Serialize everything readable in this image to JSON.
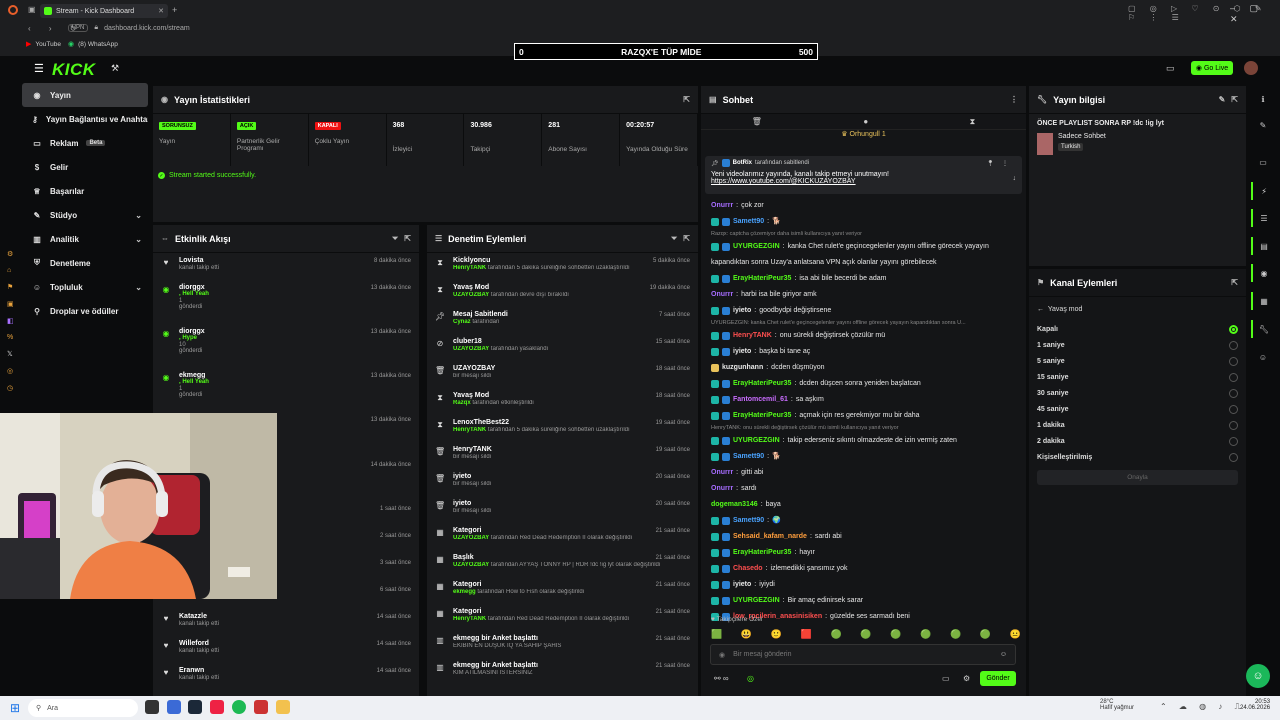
{
  "browser": {
    "tab_title": "Stream - Kick Dashboard",
    "url": "dashboard.kick.com/stream",
    "vpn": "VPN",
    "bookmarks": [
      "YouTube",
      "(8) WhatsApp"
    ]
  },
  "overlay": {
    "goal_left": "0",
    "goal_title": "RAZQX'E TÜP MİDE",
    "goal_right": "500"
  },
  "header": {
    "logo": "KICK",
    "go_live": "Go Live"
  },
  "nav": {
    "items": [
      "Yayın",
      "Yayın Bağlantısı ve Anahtarı",
      "Reklam",
      "Gelir",
      "Başarılar",
      "Stüdyo",
      "Analitik",
      "Denetleme",
      "Topluluk",
      "Droplar ve ödüller"
    ],
    "beta": "Beta"
  },
  "stats": {
    "title": "Yayın İstatistikleri",
    "items": [
      {
        "value": "SORUNSUZ",
        "label": "Yayın",
        "kind": "green"
      },
      {
        "value": "AÇIK",
        "label": "Partnerlik Gelir Programı",
        "kind": "green"
      },
      {
        "value": "KAPALI",
        "label": "Çoklu Yayın",
        "kind": "red"
      },
      {
        "value": "368",
        "label": "İzleyici",
        "kind": "num"
      },
      {
        "value": "30.986",
        "label": "Takipçi",
        "kind": "num"
      },
      {
        "value": "281",
        "label": "Abone Sayısı",
        "kind": "num"
      },
      {
        "value": "00:20:57",
        "label": "Yayında Olduğu Süre",
        "kind": "num"
      }
    ],
    "success": "Stream started successfully."
  },
  "activity": {
    "title": "Etkinlik Akışı",
    "rows": [
      {
        "icon": "heart",
        "name": "Lovista",
        "sub": "kanalı takip etti",
        "green": "",
        "time": "8 dakika önce",
        "h": 27
      },
      {
        "icon": "kick",
        "name": "diorggx",
        "sub": "1\ngönderdi",
        "green": ", Hell Yeah",
        "time": "13 dakika önce",
        "h": 44
      },
      {
        "icon": "kick",
        "name": "diorggx",
        "sub": "10\ngönderdi",
        "green": ", Hype",
        "time": "13 dakika önce",
        "h": 44
      },
      {
        "icon": "kick",
        "name": "ekmegg",
        "sub": "1\ngönderdi",
        "green": ", Hell Yeah",
        "time": "13 dakika önce",
        "h": 44
      },
      {
        "icon": "",
        "name": "",
        "sub": "",
        "green": "",
        "time": "13 dakika önce",
        "h": 45
      },
      {
        "icon": "",
        "name": "",
        "sub": "",
        "green": "",
        "time": "14 dakika önce",
        "h": 44
      },
      {
        "icon": "",
        "name": "",
        "sub": "",
        "green": "",
        "time": "1 saat önce",
        "h": 27
      },
      {
        "icon": "",
        "name": "",
        "sub": "",
        "green": "",
        "time": "2 saat önce",
        "h": 27
      },
      {
        "icon": "",
        "name": "",
        "sub": "",
        "green": "",
        "time": "3 saat önce",
        "h": 27
      },
      {
        "icon": "",
        "name": "",
        "sub": "kanalı takip etti",
        "green": "",
        "time": "6 saat önce",
        "h": 27
      },
      {
        "icon": "heart",
        "name": "Katazzle",
        "sub": "kanalı takip etti",
        "green": "",
        "time": "14 saat önce",
        "h": 27
      },
      {
        "icon": "heart",
        "name": "Willeford",
        "sub": "kanalı takip etti",
        "green": "",
        "time": "14 saat önce",
        "h": 27
      },
      {
        "icon": "heart",
        "name": "Eranwn",
        "sub": "kanalı takip etti",
        "green": "",
        "time": "14 saat önce",
        "h": 27
      }
    ]
  },
  "moderation": {
    "title": "Denetim Eylemleri",
    "rows": [
      {
        "icon": "hourglass",
        "name": "Kicklyoncu",
        "user": "HenryTANK",
        "sub": " tarafından 5 dakika süreliğine sohbetten uzaklaştırıldı",
        "time": "5 dakika önce"
      },
      {
        "icon": "hourglass",
        "name": "Yavaş Mod",
        "user": "UZAYOZBAY",
        "sub": " tarafından devre dışı bırakıldı",
        "time": "19 dakika önce"
      },
      {
        "icon": "pin",
        "name": "Mesaj Sabitlendi",
        "user": "Cynaz",
        "sub": " tarafından",
        "time": "7 saat önce"
      },
      {
        "icon": "ban",
        "name": "cluber18",
        "user": "UZAYOZBAY",
        "sub": " tarafından yasaklandı",
        "time": "15 saat önce"
      },
      {
        "icon": "trash",
        "name": "UZAYOZBAY",
        "user": "",
        "sub": "bir mesajı sildi",
        "time": "18 saat önce"
      },
      {
        "icon": "hourglass",
        "name": "Yavaş Mod",
        "user": "Razqx",
        "sub": " tarafından etkinleştirildi",
        "time": "18 saat önce"
      },
      {
        "icon": "hourglass",
        "name": "LenoxTheBest22",
        "user": "HenryTANK",
        "sub": " tarafından 5 dakika süreliğine sohbetten uzaklaştırıldı",
        "time": "19 saat önce"
      },
      {
        "icon": "trash",
        "name": "HenryTANK",
        "user": "",
        "sub": "bir mesajı sildi",
        "time": "19 saat önce"
      },
      {
        "icon": "trash",
        "name": "iyieto",
        "user": "",
        "sub": "bir mesajı sildi",
        "time": "20 saat önce"
      },
      {
        "icon": "trash",
        "name": "iyieto",
        "user": "",
        "sub": "bir mesajı sildi",
        "time": "20 saat önce"
      },
      {
        "icon": "cat",
        "name": "Kategori",
        "user": "UZAYOZBAY",
        "sub": " tarafından Red Dead Redemption II olarak değiştirildi",
        "time": "21 saat önce"
      },
      {
        "icon": "cat",
        "name": "Başlık",
        "user": "UZAYOZBAY",
        "sub": " tarafından AYYAŞ TONNY RP | RDR !dc !ig lyt olarak değiştirildi",
        "time": "21 saat önce"
      },
      {
        "icon": "cat",
        "name": "Kategori",
        "user": "ekmegg",
        "sub": " tarafından How to Fish olarak değiştirildi",
        "time": "21 saat önce"
      },
      {
        "icon": "cat",
        "name": "Kategori",
        "user": "HenryTANK",
        "sub": " tarafından Red Dead Redemption II olarak değiştirildi",
        "time": "21 saat önce"
      },
      {
        "icon": "poll",
        "name": "ekmegg bir Anket başlattı",
        "user": "",
        "sub": "EKİBİN EN DÜŞÜK IQ YA SAHİP ŞAHIS",
        "time": "21 saat önce"
      },
      {
        "icon": "poll",
        "name": "ekmegg bir Anket başlattı",
        "user": "",
        "sub": "KİM ATILMASINI İSTERSİNİZ",
        "time": "21 saat önce"
      }
    ]
  },
  "chat": {
    "title": "Sohbet",
    "top_user": "Orhungull",
    "top_count": "1",
    "pinned_by": "BotRix",
    "pinned_label": "tarafından sabitlendi",
    "pinned_text": "Yeni videolarımız yayında, kanalı takip etmeyi unutmayın!",
    "pinned_link": "https://www.youtube.com/@KICKUZAYOZBAY",
    "messages": [
      {
        "u": "Onurrr",
        "c": "#a66cff",
        "m": "çok zor",
        "b": "",
        "small": false
      },
      {
        "u": "Samett90",
        "c": "#4aa3ff",
        "m": "🐕",
        "b": "bb",
        "small": false
      },
      {
        "u": "",
        "c": "#888",
        "m": "Razqx: captcha çözemiyor daha isimli kullanıcıya yanıt veriyor",
        "b": "",
        "small": true
      },
      {
        "u": "UYURGEZGIN",
        "c": "#53fc18",
        "m": "kanka Chet rulet'e geçincegelenler yayını offline görecek yayayın",
        "b": "bb",
        "small": false
      },
      {
        "u": "",
        "c": "#e8e8e8",
        "m": "kapandıktan sonra Uzay'a anlatsana VPN açık olanlar yayını görebilecek",
        "b": "",
        "small": false
      },
      {
        "u": "ErayHateriPeur35",
        "c": "#53fc18",
        "m": "isa abi bile becerdi be adam",
        "b": "bb",
        "small": false
      },
      {
        "u": "Onurrr",
        "c": "#a66cff",
        "m": "harbi isa bile giriyor amk",
        "b": "",
        "small": false
      },
      {
        "u": "iyieto",
        "c": "#e8e8e8",
        "m": "goodbydpi değiştirsene",
        "b": "bb",
        "small": false
      },
      {
        "u": "",
        "c": "#888",
        "m": "UYURGEZGIN: kanka Chet rulet'e geçincegelenler yayını offline görecek yayayın kapandıktan sonra U...",
        "b": "",
        "small": true
      },
      {
        "u": "HenryTANK",
        "c": "#ff4f4f",
        "m": "onu sürekli değiştirsek çözülür mü",
        "b": "bb",
        "small": false
      },
      {
        "u": "iyieto",
        "c": "#e8e8e8",
        "m": "başka bi tane aç",
        "b": "bb",
        "small": false
      },
      {
        "u": "kuzgunhann",
        "c": "#e8e8e8",
        "m": "dcden düşmüyon",
        "b": "y",
        "small": false
      },
      {
        "u": "ErayHateriPeur35",
        "c": "#53fc18",
        "m": "dcden düşcen sonra yeniden başlatcan",
        "b": "bb",
        "small": false
      },
      {
        "u": "Fantomcemil_61",
        "c": "#c96cff",
        "m": "sa aşkım",
        "b": "bb",
        "small": false
      },
      {
        "u": "ErayHateriPeur35",
        "c": "#53fc18",
        "m": "açmak için res gerekmiyor mu bir daha",
        "b": "bb",
        "small": false
      },
      {
        "u": "",
        "c": "#888",
        "m": "HenryTANK: onu sürekli değiştirsek çözülür mü isimli kullanıcıya yanıt veriyor",
        "b": "",
        "small": true
      },
      {
        "u": "UYURGEZGIN",
        "c": "#53fc18",
        "m": "takip ederseniz sıkıntı olmazdeste de izin vermiş zaten",
        "b": "bb",
        "small": false
      },
      {
        "u": "Samett90",
        "c": "#4aa3ff",
        "m": "🐕",
        "b": "bb",
        "small": false
      },
      {
        "u": "Onurrr",
        "c": "#a66cff",
        "m": "gitti abi",
        "b": "",
        "small": false
      },
      {
        "u": "Onurrr",
        "c": "#a66cff",
        "m": "sardı",
        "b": "",
        "small": false
      },
      {
        "u": "dogeman3146",
        "c": "#53fc18",
        "m": "baya",
        "b": "",
        "small": false
      },
      {
        "u": "Samett90",
        "c": "#4aa3ff",
        "m": "🌍",
        "b": "bb",
        "small": false
      },
      {
        "u": "Sehsaid_kafam_narde",
        "c": "#ff9e3d",
        "m": "sardı abi",
        "b": "bb",
        "small": false
      },
      {
        "u": "ErayHateriPeur35",
        "c": "#53fc18",
        "m": "hayır",
        "b": "bb",
        "small": false
      },
      {
        "u": "Chasedo",
        "c": "#ff4f4f",
        "m": "izlemedikki şansımız yok",
        "b": "bb",
        "small": false
      },
      {
        "u": "iyieto",
        "c": "#e8e8e8",
        "m": "iyiydi",
        "b": "bb",
        "small": false
      },
      {
        "u": "UYURGEZGIN",
        "c": "#53fc18",
        "m": "Bir amaç edinirsek sarar",
        "b": "bb",
        "small": false
      },
      {
        "u": "low_rpcilerin_anasinisiken",
        "c": "#ff4f4f",
        "m": "güzelde ses sarmadı beni",
        "b": "bb",
        "small": false
      }
    ],
    "followers_only": "Takipçilere Özel",
    "input_placeholder": "Bir mesaj gönderin",
    "send": "Gönder"
  },
  "info": {
    "title": "Yayın bilgisi",
    "stream_title": "ÖNCE PLAYLIST SONRA RP !dc !ig lyt",
    "category": "Sadece Sohbet",
    "language": "Turkish"
  },
  "channel": {
    "title": "Kanal Eylemleri",
    "back": "Yavaş mod",
    "options": [
      "Kapalı",
      "1 saniye",
      "5 saniye",
      "15 saniye",
      "30 saniye",
      "45 saniye",
      "1 dakika",
      "2 dakika",
      "Kişiselleştirilmiş"
    ],
    "selected": 0,
    "confirm": "Onayla"
  },
  "taskbar": {
    "search": "Ara",
    "weather_temp": "28°C",
    "weather_desc": "Hafif yağmur",
    "time": "20:53",
    "date": "24.06.2026"
  }
}
